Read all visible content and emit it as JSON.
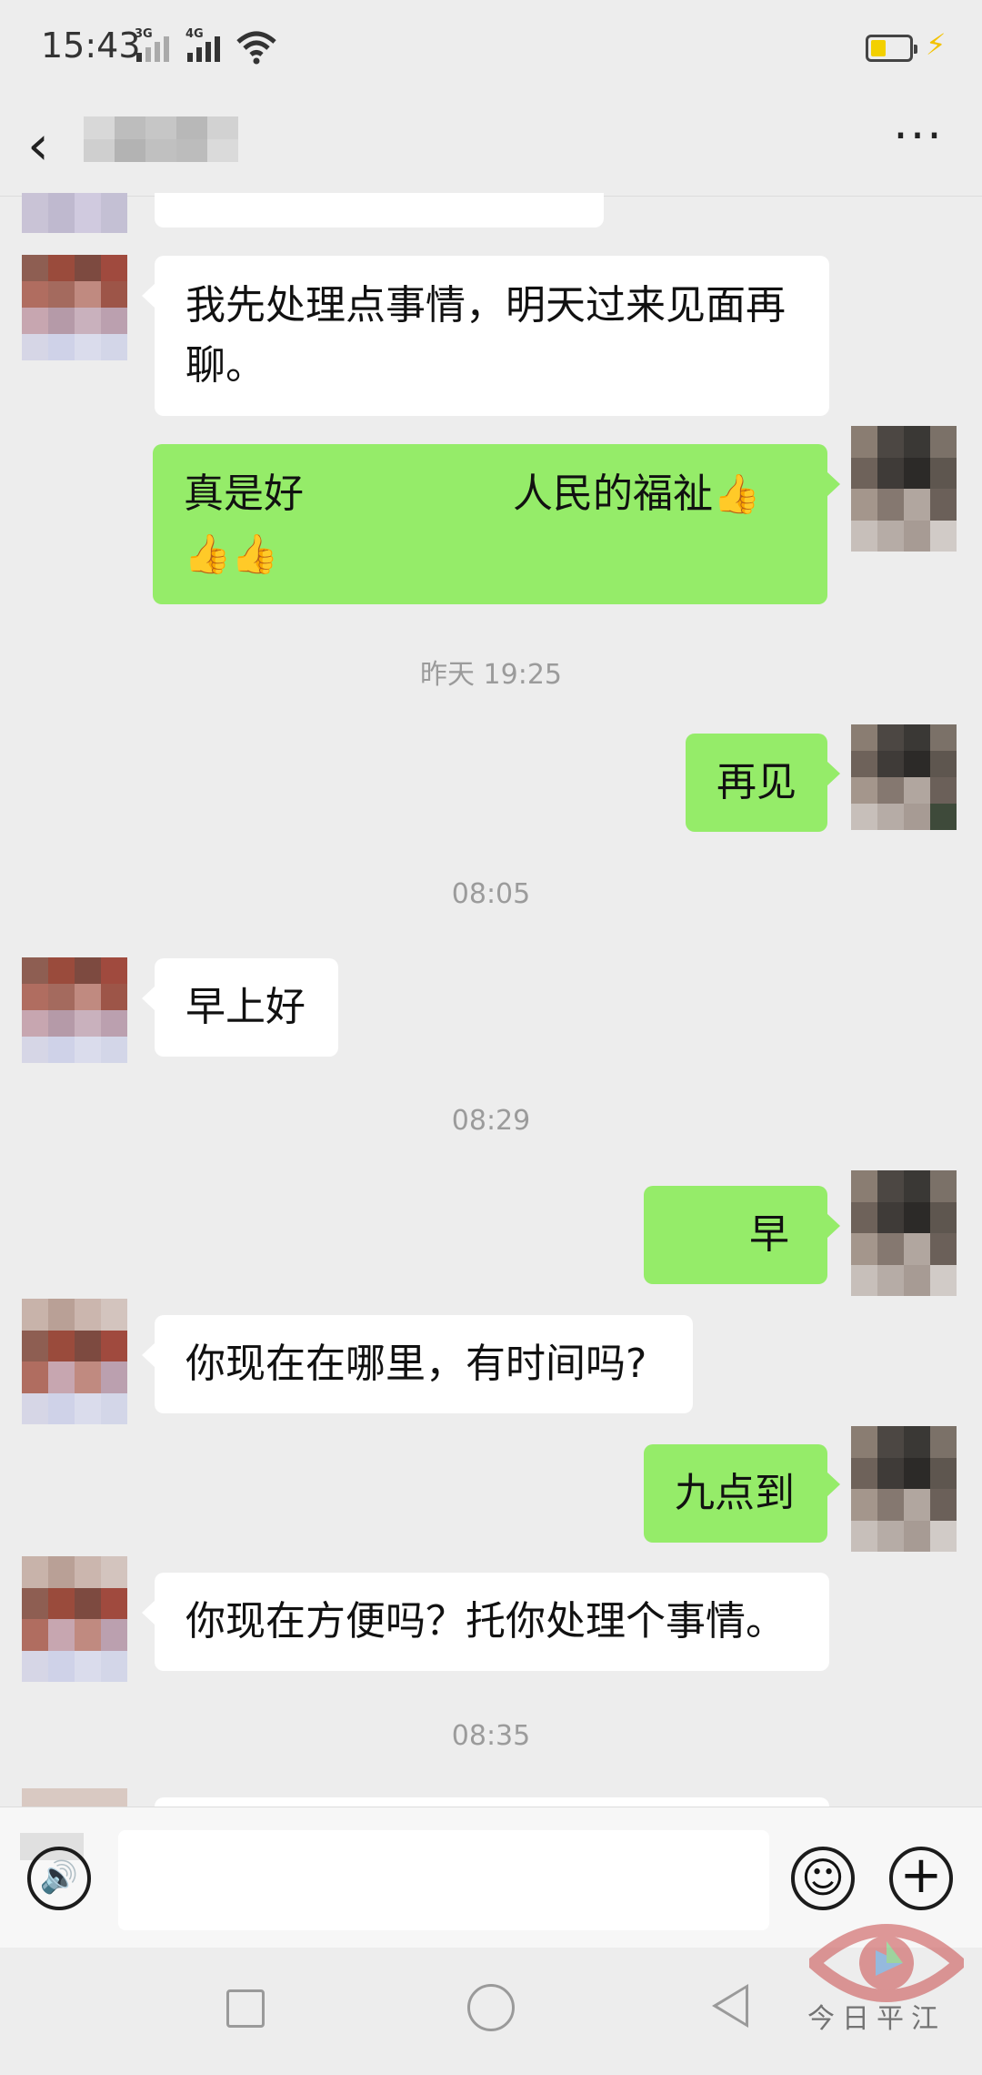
{
  "status_bar": {
    "time": "15:43",
    "signal_1_label": "3G",
    "signal_2_label": "4G"
  },
  "header": {
    "back_icon": "‹",
    "more_icon": "···"
  },
  "messages": [
    {
      "side": "in",
      "text_line1": "我先处理点事情，明天过来见面再",
      "text_line2": "聊。"
    },
    {
      "side": "out",
      "prefix": "真是好",
      "suffix": "人民的福祉"
    },
    {
      "side": "out",
      "text": "再见"
    },
    {
      "side": "in",
      "text": "早上好"
    },
    {
      "side": "out",
      "text": "早"
    },
    {
      "side": "in",
      "text": "你现在在哪里，有时间吗?"
    },
    {
      "side": "out",
      "text": "九点到"
    },
    {
      "side": "in",
      "text": "你现在方便吗？托你处理个事情。"
    }
  ],
  "timestamps": [
    "昨天 19:25",
    "08:05",
    "08:29",
    "08:35"
  ],
  "input_bar": {
    "placeholder": ""
  },
  "watermark": {
    "text": "今日平江"
  },
  "colors": {
    "chat_background": "#ededed",
    "bubble_out": "#95ec69",
    "bubble_in": "#ffffff",
    "timestamp_text": "#9b9b9b"
  }
}
